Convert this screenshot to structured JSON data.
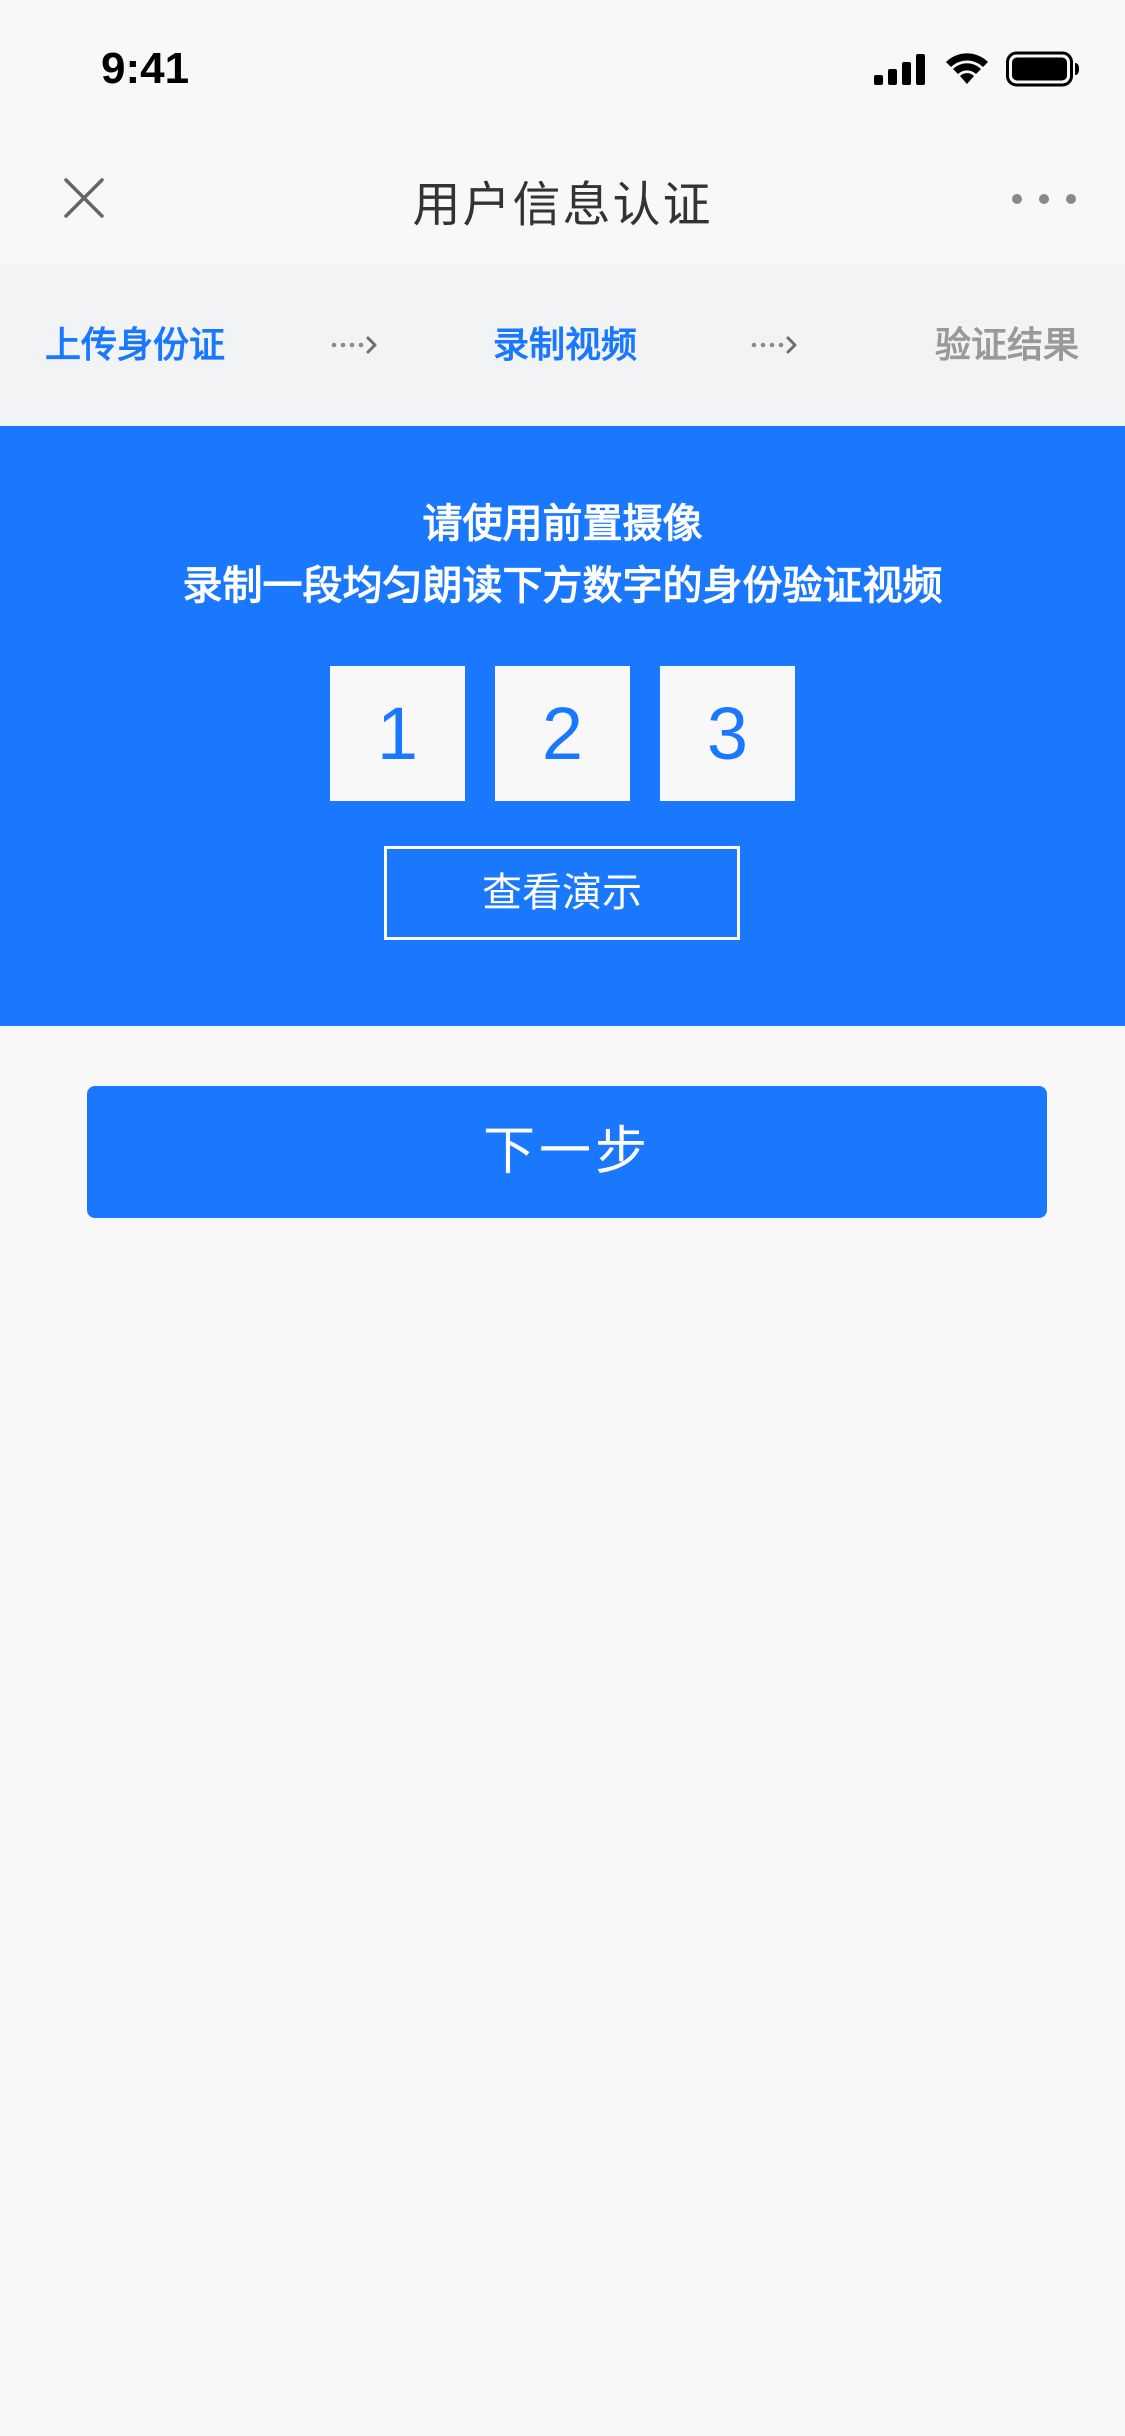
{
  "status_bar": {
    "time": "9:41",
    "icons": [
      "cellular-signal-icon",
      "wifi-icon",
      "battery-icon"
    ]
  },
  "nav": {
    "title": "用户信息认证",
    "left_icon": "close-icon",
    "right_icon": "more-icon"
  },
  "steps": {
    "items": [
      {
        "label": "上传身份证",
        "state": "active"
      },
      {
        "label": "录制视频",
        "state": "active"
      },
      {
        "label": "验证结果",
        "state": "inactive"
      }
    ],
    "separator_icon": "dotted-arrow-icon"
  },
  "banner": {
    "line1": "请使用前置摄像",
    "line2": "录制一段均匀朗读下方数字的身份验证视频",
    "digits": [
      "1",
      "2",
      "3"
    ],
    "demo_button": "查看演示"
  },
  "actions": {
    "next_button": "下一步"
  },
  "colors": {
    "primary": "#1A78FF",
    "background": "#F8F8F8",
    "steps_background": "#F2F3F5",
    "inactive_text": "#999999",
    "title_text": "#333333"
  }
}
